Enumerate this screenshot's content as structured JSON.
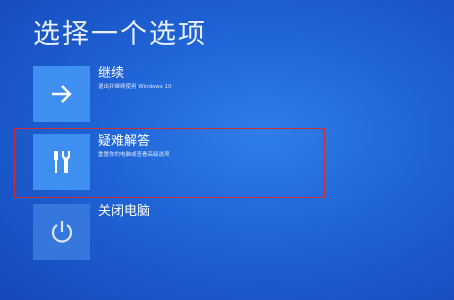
{
  "page": {
    "title": "选择一个选项"
  },
  "options": [
    {
      "label": "继续",
      "desc": "退出并继续使用 Windows 10",
      "icon": "arrow-right-icon"
    },
    {
      "label": "疑难解答",
      "desc": "重置你的电脑或查看高级选项",
      "icon": "tools-icon"
    },
    {
      "label": "关闭电脑",
      "desc": "",
      "icon": "power-icon"
    }
  ],
  "colors": {
    "background": "#1f63d6",
    "tile": "#3f8ff0",
    "highlight": "#c8303a"
  }
}
